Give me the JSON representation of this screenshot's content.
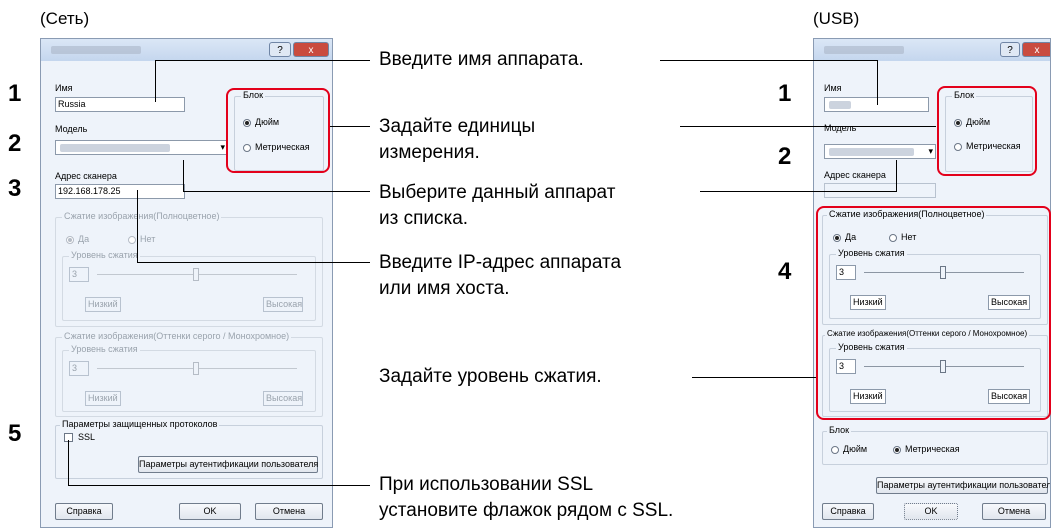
{
  "captions": {
    "network": "(Сеть)",
    "usb": "(USB)"
  },
  "steps": {
    "one": "1",
    "two": "2",
    "three": "3",
    "four": "4",
    "five": "5"
  },
  "annotations": {
    "enter_name": "Введите имя аппарата.",
    "units": [
      "Задайте единицы",
      "измерения."
    ],
    "select_device": [
      "Выберите данный аппарат",
      "из списка."
    ],
    "enter_ip": [
      "Введите IP-адрес аппарата",
      "или имя хоста."
    ],
    "compression": "Задайте уровень сжатия.",
    "ssl": [
      "При использовании SSL",
      "установите флажок рядом с SSL."
    ]
  },
  "net_dialog": {
    "title_buttons": [
      "?",
      "x"
    ],
    "name_label": "Имя",
    "name_value": "Russia",
    "model_label": "Модель",
    "scanner_label": "Адрес сканера",
    "scanner_value": "192.168.178.25",
    "unit_group": "Блок",
    "unit_inch": "Дюйм",
    "unit_metric": "Метрическая",
    "color_group": "Сжатие изображения(Полноцветное)",
    "yes": "Да",
    "no": "Нет",
    "level_group": "Уровень сжатия",
    "level_value": "3",
    "low": "Низкий",
    "high": "Высокая",
    "gray_group": "Сжатие изображения(Оттенки серого / Монохромное)",
    "gray_level_group": "Уровень сжатия",
    "gray_level_value": "3",
    "secure_group": "Параметры защищенных протоколов",
    "ssl": "SSL",
    "auth_button": "Параметры аутентификации пользователя",
    "help_button": "Справка",
    "ok_button": "OK",
    "cancel_button": "Отмена"
  },
  "usb_dialog": {
    "title_buttons": [
      "?",
      "x"
    ],
    "name_label": "Имя",
    "model_label": "Модель",
    "scanner_label": "Адрес сканера",
    "unit_group": "Блок",
    "unit_inch": "Дюйм",
    "unit_metric": "Метрическая",
    "color_group": "Сжатие изображения(Полноцветное)",
    "yes": "Да",
    "no": "Нет",
    "level_group": "Уровень сжатия",
    "level_value": "3",
    "low": "Низкий",
    "high": "Высокая",
    "gray_group": "Сжатие изображения(Оттенки серого / Монохромное)",
    "gray_level_group": "Уровень сжатия",
    "gray_level_value": "3",
    "unit_group2": "Блок",
    "unit_inch2": "Дюйм",
    "unit_metric2": "Метрическая",
    "auth_button": "Параметры аутентификации пользователя",
    "help_button": "Справка",
    "ok_button": "OK",
    "cancel_button": "Отмена"
  },
  "colors": {
    "highlight": "#e3001b",
    "dialog_bg": "#eef3fa"
  }
}
